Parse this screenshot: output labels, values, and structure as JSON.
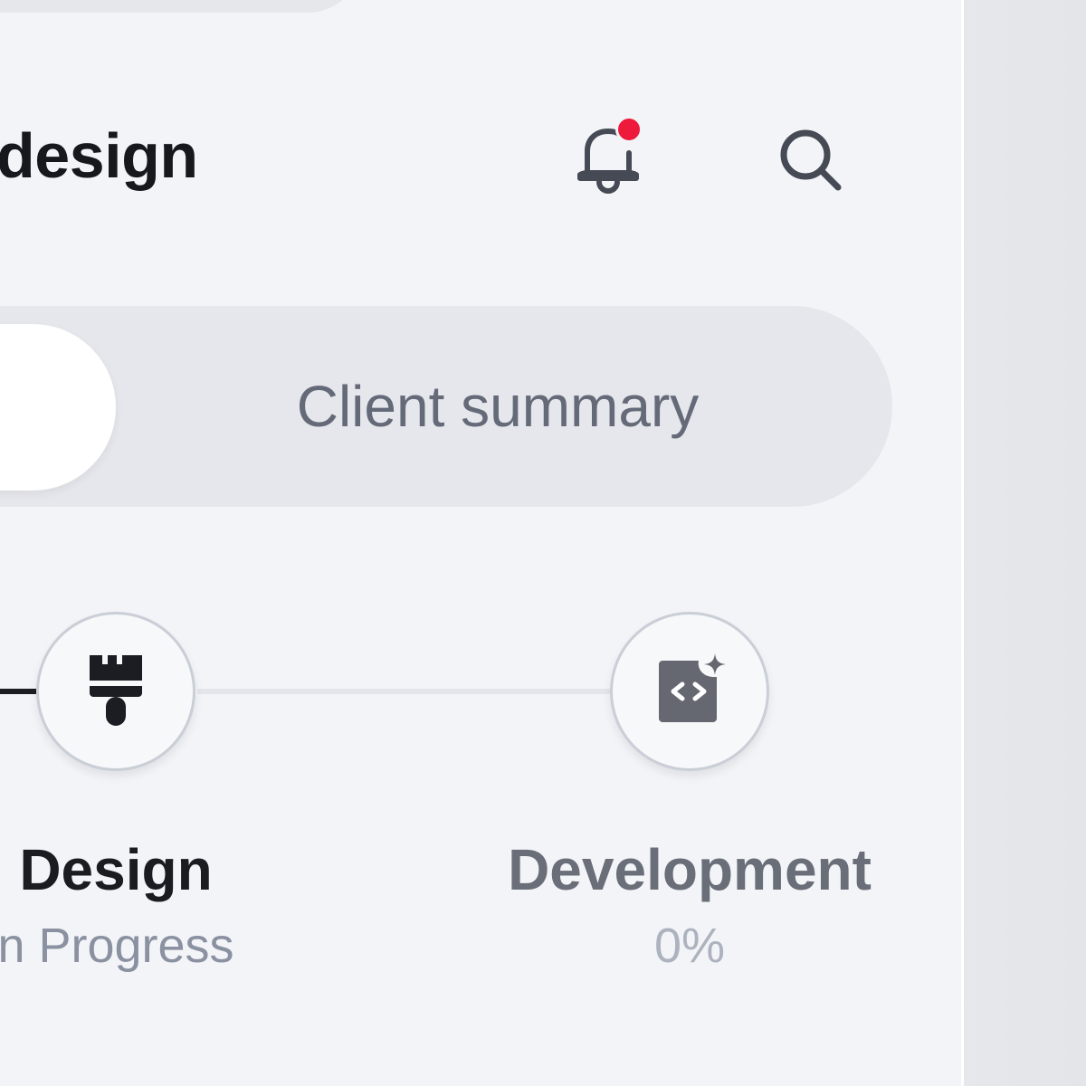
{
  "header": {
    "title": "design",
    "notification_badge_color": "#ed1a3b",
    "icons": [
      "bell-icon",
      "search-icon"
    ]
  },
  "tabs": [
    {
      "label": "",
      "active": true
    },
    {
      "label": "Client summary",
      "active": false
    }
  ],
  "progress_steps": [
    {
      "name": "Design",
      "status": "n Progress",
      "icon": "paintbrush-icon",
      "state": "in-progress"
    },
    {
      "name": "Development",
      "status": "0%",
      "icon": "code-sparkle-icon",
      "state": "pending"
    }
  ],
  "colors": {
    "background": "#f3f4f8",
    "accent_dark": "#1b1d22",
    "muted_text": "#646a78"
  }
}
